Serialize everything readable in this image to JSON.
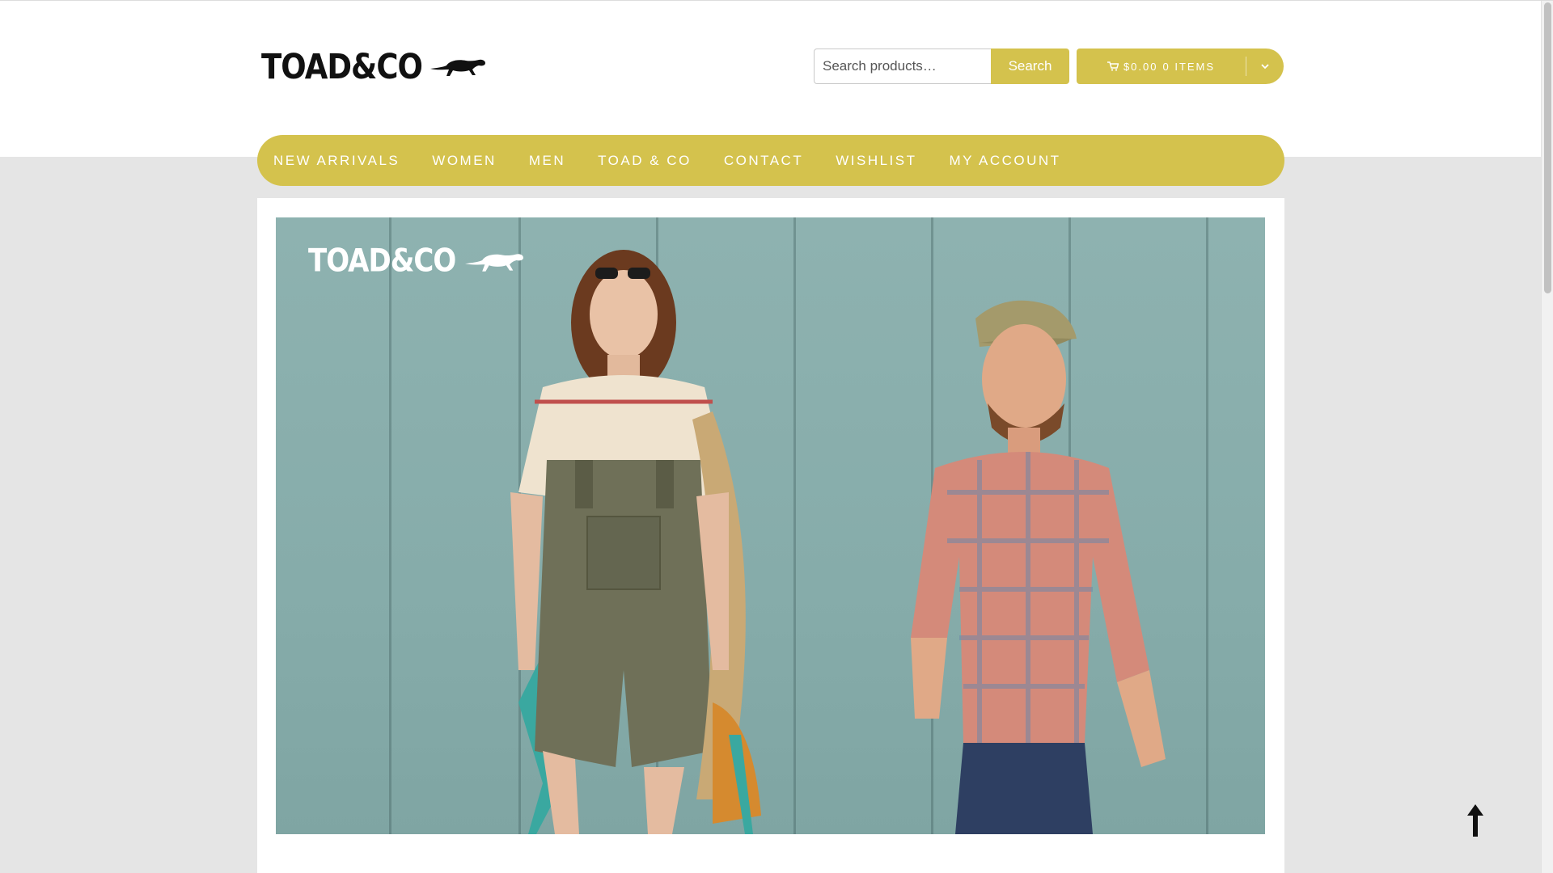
{
  "brand": {
    "logo_text": "TOAD&CO",
    "logo_icon": "lizard-icon"
  },
  "search": {
    "placeholder": "Search products…",
    "button_label": "Search"
  },
  "cart": {
    "icon": "cart-icon",
    "amount": "$0.00",
    "items": "0 ITEMS",
    "toggle_icon": "chevron-down-icon"
  },
  "nav": {
    "items": [
      {
        "label": "NEW ARRIVALS"
      },
      {
        "label": "WOMEN"
      },
      {
        "label": "MEN"
      },
      {
        "label": "TOAD & CO"
      },
      {
        "label": "CONTACT"
      },
      {
        "label": "WISHLIST"
      },
      {
        "label": "MY ACCOUNT"
      }
    ]
  },
  "hero": {
    "logo_text": "TOAD&CO",
    "logo_icon": "lizard-icon"
  },
  "scroll_top": {
    "icon": "arrow-up-icon"
  },
  "colors": {
    "accent": "#d4c24d",
    "background": "#e5e5e5",
    "hero_wall": "#8eb2b0"
  }
}
